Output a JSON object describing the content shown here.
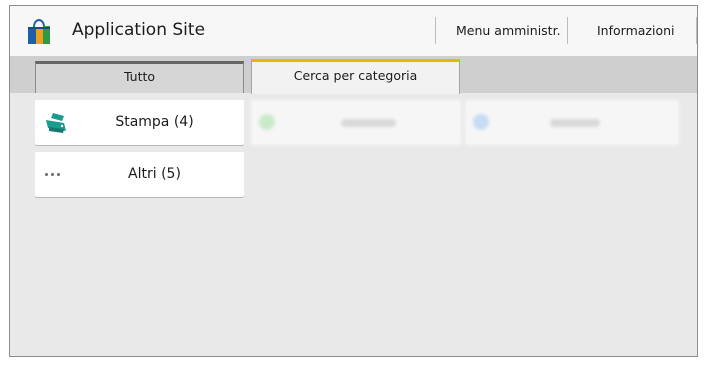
{
  "header": {
    "title": "Application Site",
    "admin_menu": "Menu amministr.",
    "info": "Informazioni"
  },
  "tabs": [
    {
      "label": "Tutto",
      "selected": false
    },
    {
      "label": "Cerca per categoria",
      "selected": true
    }
  ],
  "categories": [
    {
      "label": "Stampa (4)",
      "icon": "printer-icon"
    },
    {
      "label": "Altri (5)",
      "icon": "more-dots-icon"
    }
  ],
  "colors": {
    "active_tab_accent": "#e8b800",
    "printer_icon": "#1a9b8f",
    "bag_blue": "#1f5ea8",
    "bag_gold": "#e9a21b",
    "bag_green": "#2f9a46"
  }
}
